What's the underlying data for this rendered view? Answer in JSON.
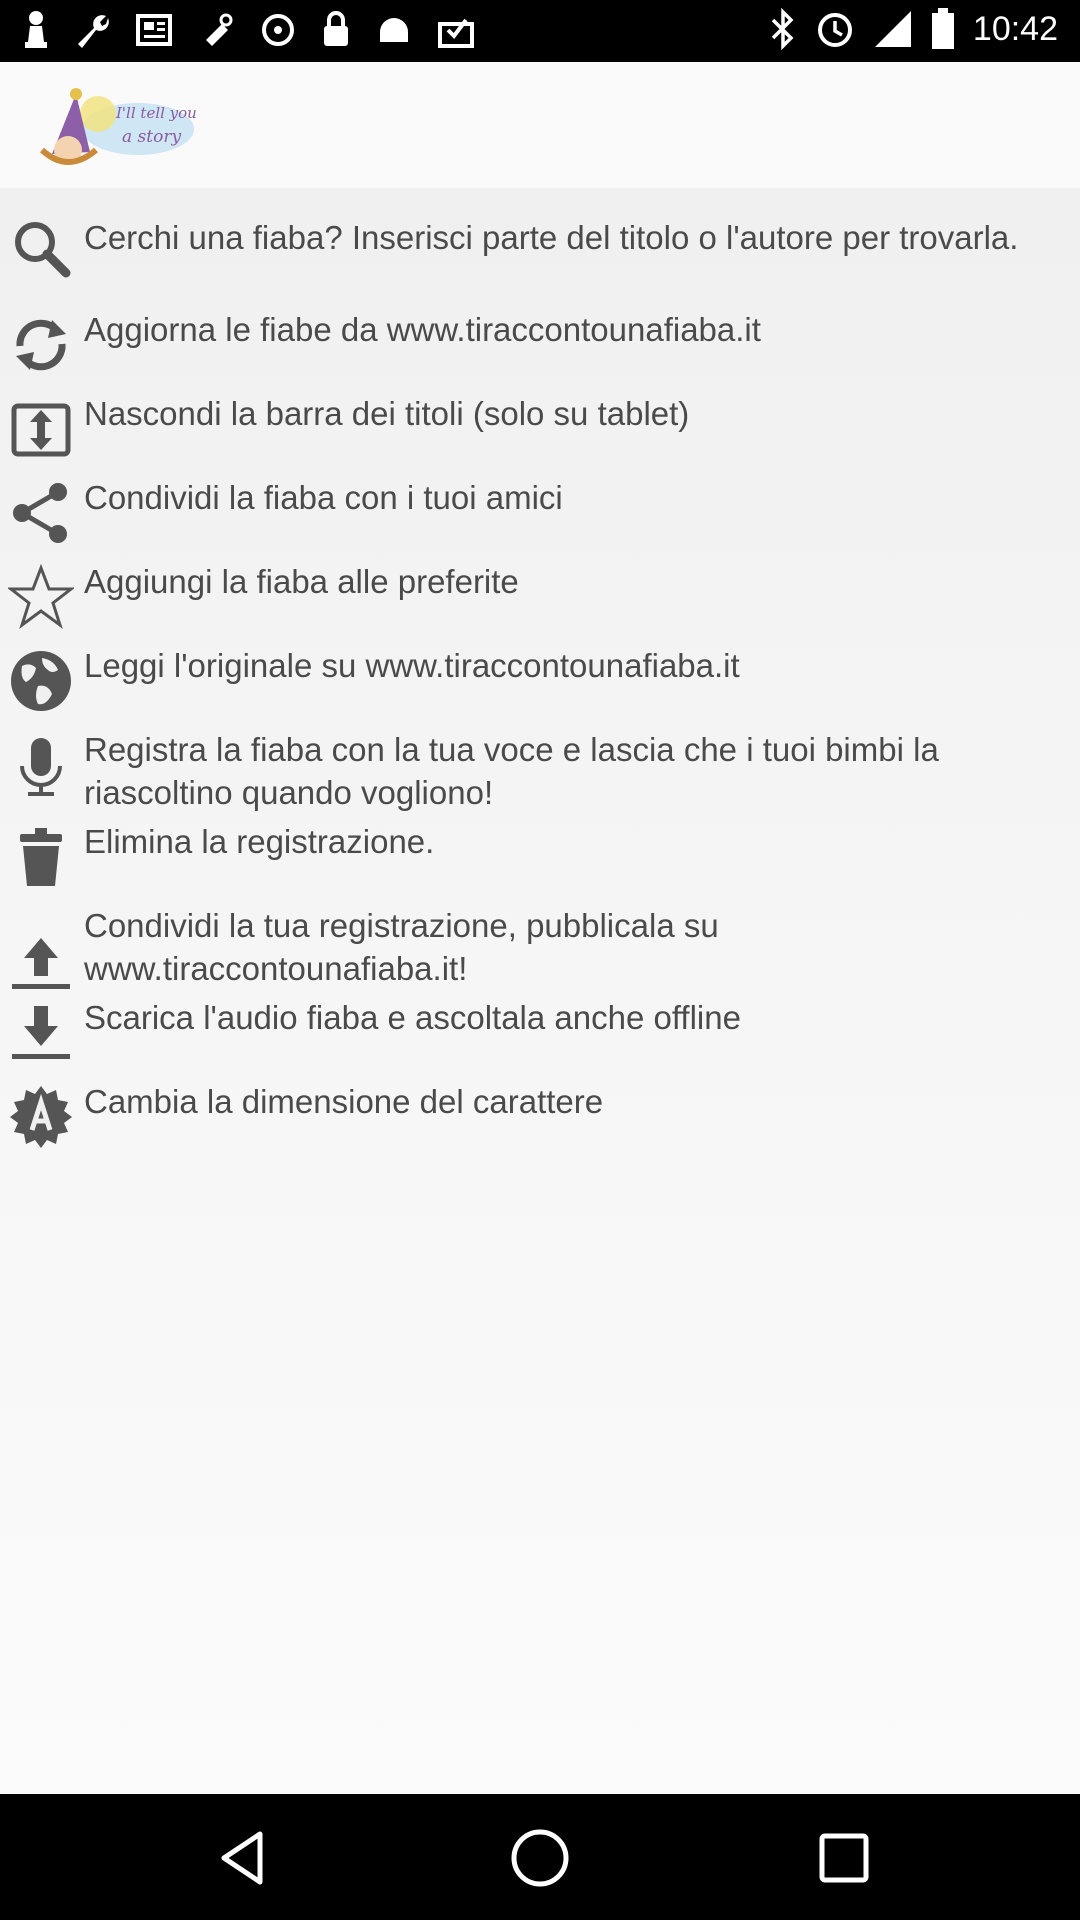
{
  "status_bar": {
    "time": "10:42"
  },
  "header": {
    "logo_text_line1": "I'll tell you",
    "logo_text_line2": "a story"
  },
  "menu": {
    "items": [
      {
        "icon": "search-icon",
        "label": "Cerchi una fiaba? Inserisci parte del titolo o l'autore per trovarla."
      },
      {
        "icon": "refresh-icon",
        "label": "Aggiorna le fiabe da www.tiraccontounafiaba.it"
      },
      {
        "icon": "expand-icon",
        "label": "Nascondi la barra dei titoli (solo su tablet)"
      },
      {
        "icon": "share-icon",
        "label": "Condividi la fiaba con i tuoi amici"
      },
      {
        "icon": "star-icon",
        "label": "Aggiungi la fiaba alle preferite"
      },
      {
        "icon": "globe-icon",
        "label": "Leggi l'originale su www.tiraccontounafiaba.it"
      },
      {
        "icon": "microphone-icon",
        "label": "Registra la fiaba con la tua voce e lascia che i tuoi bimbi la riascoltino quando vogliono!"
      },
      {
        "icon": "trash-icon",
        "label": "Elimina la registrazione."
      },
      {
        "icon": "upload-icon",
        "label": "Condividi la tua registrazione, pubblicala su www.tiraccontounafiaba.it!"
      },
      {
        "icon": "download-icon",
        "label": "Scarica l'audio fiaba e ascoltala anche offline"
      },
      {
        "icon": "font-size-icon",
        "label": "Cambia la dimensione del carattere"
      }
    ]
  },
  "colors": {
    "text": "#4a4a4a",
    "icon": "#555555",
    "background": "#f2f2f2"
  }
}
